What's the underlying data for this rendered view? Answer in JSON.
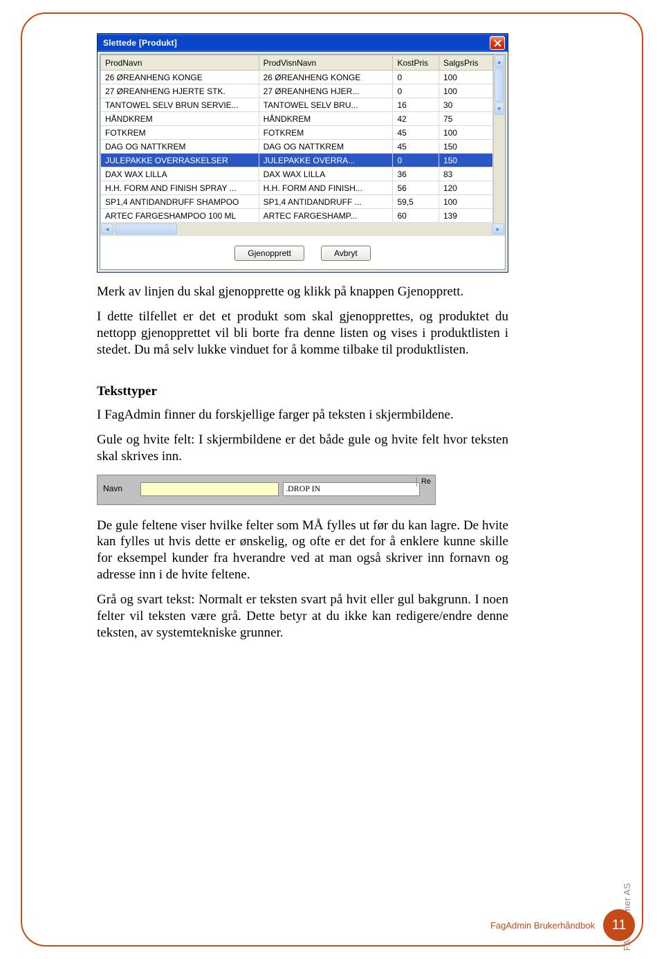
{
  "window1": {
    "title": "Slettede [Produkt]",
    "columns": [
      "ProdNavn",
      "ProdVisnNavn",
      "KostPris",
      "SalgsPris"
    ],
    "rows": [
      {
        "prod": "26 ØREANHENG KONGE",
        "visn": "26 ØREANHENG KONGE",
        "kost": "0",
        "salg": "100",
        "sel": false
      },
      {
        "prod": "27 ØREANHENG HJERTE STK.",
        "visn": "27 ØREANHENG HJER...",
        "kost": "0",
        "salg": "100",
        "sel": false
      },
      {
        "prod": "TANTOWEL SELV BRUN SERVIE...",
        "visn": "TANTOWEL SELV BRU...",
        "kost": "16",
        "salg": "30",
        "sel": false
      },
      {
        "prod": "HÅNDKREM",
        "visn": "HÅNDKREM",
        "kost": "42",
        "salg": "75",
        "sel": false
      },
      {
        "prod": "FOTKREM",
        "visn": "FOTKREM",
        "kost": "45",
        "salg": "100",
        "sel": false
      },
      {
        "prod": "DAG OG NATTKREM",
        "visn": "DAG OG NATTKREM",
        "kost": "45",
        "salg": "150",
        "sel": false
      },
      {
        "prod": "JULEPAKKE  OVERRASKELSER",
        "visn": "JULEPAKKE  OVERRA...",
        "kost": "0",
        "salg": "150",
        "sel": true
      },
      {
        "prod": "DAX WAX LILLA",
        "visn": "DAX WAX LILLA",
        "kost": "36",
        "salg": "83",
        "sel": false
      },
      {
        "prod": "H.H. FORM AND FINISH SPRAY ...",
        "visn": "H.H. FORM AND FINISH...",
        "kost": "56",
        "salg": "120",
        "sel": false
      },
      {
        "prod": "SP1,4 ANTIDANDRUFF SHAMPOO",
        "visn": "SP1,4 ANTIDANDRUFF ...",
        "kost": "59,5",
        "salg": "100",
        "sel": false
      },
      {
        "prod": "ARTEC FARGESHAMPOO 100 ML",
        "visn": "ARTEC FARGESHAMP...",
        "kost": "60",
        "salg": "139",
        "sel": false
      }
    ],
    "buttons": {
      "restore": "Gjenopprett",
      "cancel": "Avbryt"
    }
  },
  "para1a": "Merk av linjen du skal gjenopprette og klikk på knappen Gjenopprett.",
  "para1b": "I dette tilfellet er det et produkt som skal gjenopprettes, og produktet du nettopp gjenopprettet vil bli borte fra denne listen og vises i produktlisten i stedet. Du må selv lukke vinduet for å komme tilbake til produktlisten.",
  "heading2": "Teksttyper",
  "para2a": "I FagAdmin finner du forskjellige farger på teksten i skjermbildene.",
  "para2b": "Gule og hvite felt: I skjermbildene er det både gule og hvite felt hvor teksten skal skrives inn.",
  "window2": {
    "corner": "Re",
    "label": "Navn",
    "dropin_value": ".DROP IN"
  },
  "para3": "De gule feltene viser hvilke felter som MÅ fylles ut før du kan lagre. De hvite kan fylles ut hvis dette er ønskelig, og ofte er det for å enklere kunne skille for eksempel kunder fra hverandre ved at man også skriver inn fornavn og adresse inn i de hvite feltene.",
  "para4": "Grå og svart tekst: Normalt er teksten svart på hvit eller gul bakgrunn. I noen felter vil teksten være grå. Dette betyr at du ikke kan redigere/endre denne teksten, av systemtekniske grunner.",
  "footer": {
    "book": "FagAdmin Brukerhåndbok",
    "page": "11",
    "company": "FA Systemer AS"
  }
}
